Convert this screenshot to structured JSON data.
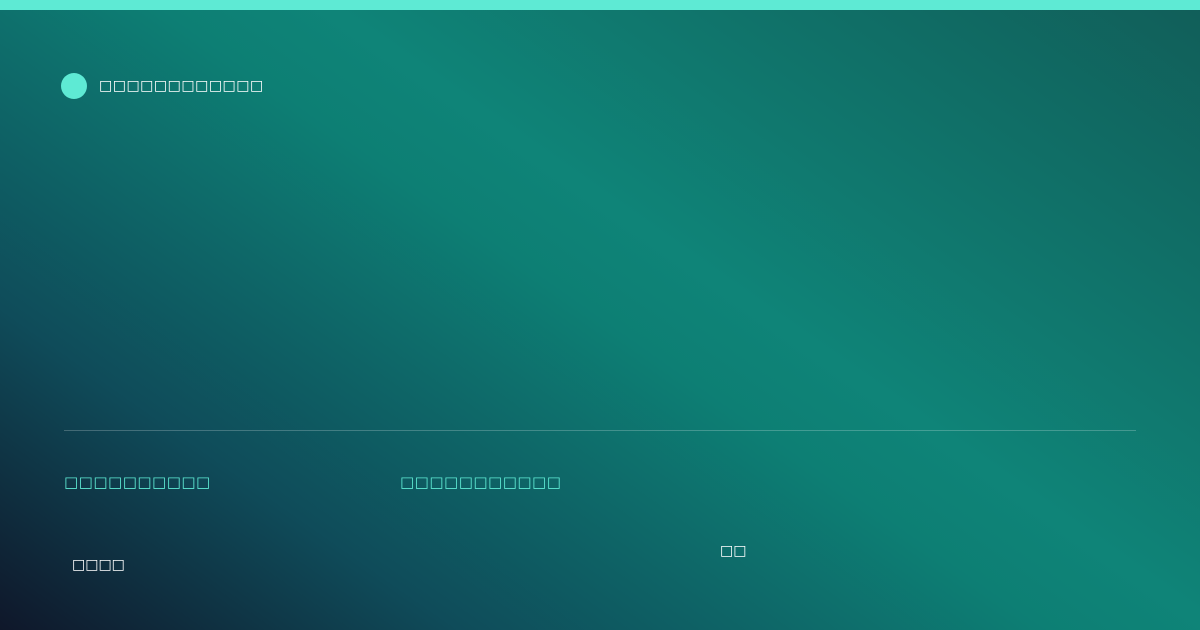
{
  "brand": {
    "name": "□□□□□□□□□□□□"
  },
  "meta": {
    "left_label": "□□□□□□□□□□",
    "mid_label": "□□□□□□□□□□□"
  },
  "footer": {
    "left_label": "□□□□",
    "right_label": "□□"
  },
  "colors": {
    "accent": "#5eead4",
    "background_start": "#0f172a",
    "background_mid": "#0d7f74",
    "background_end": "#115e59"
  }
}
